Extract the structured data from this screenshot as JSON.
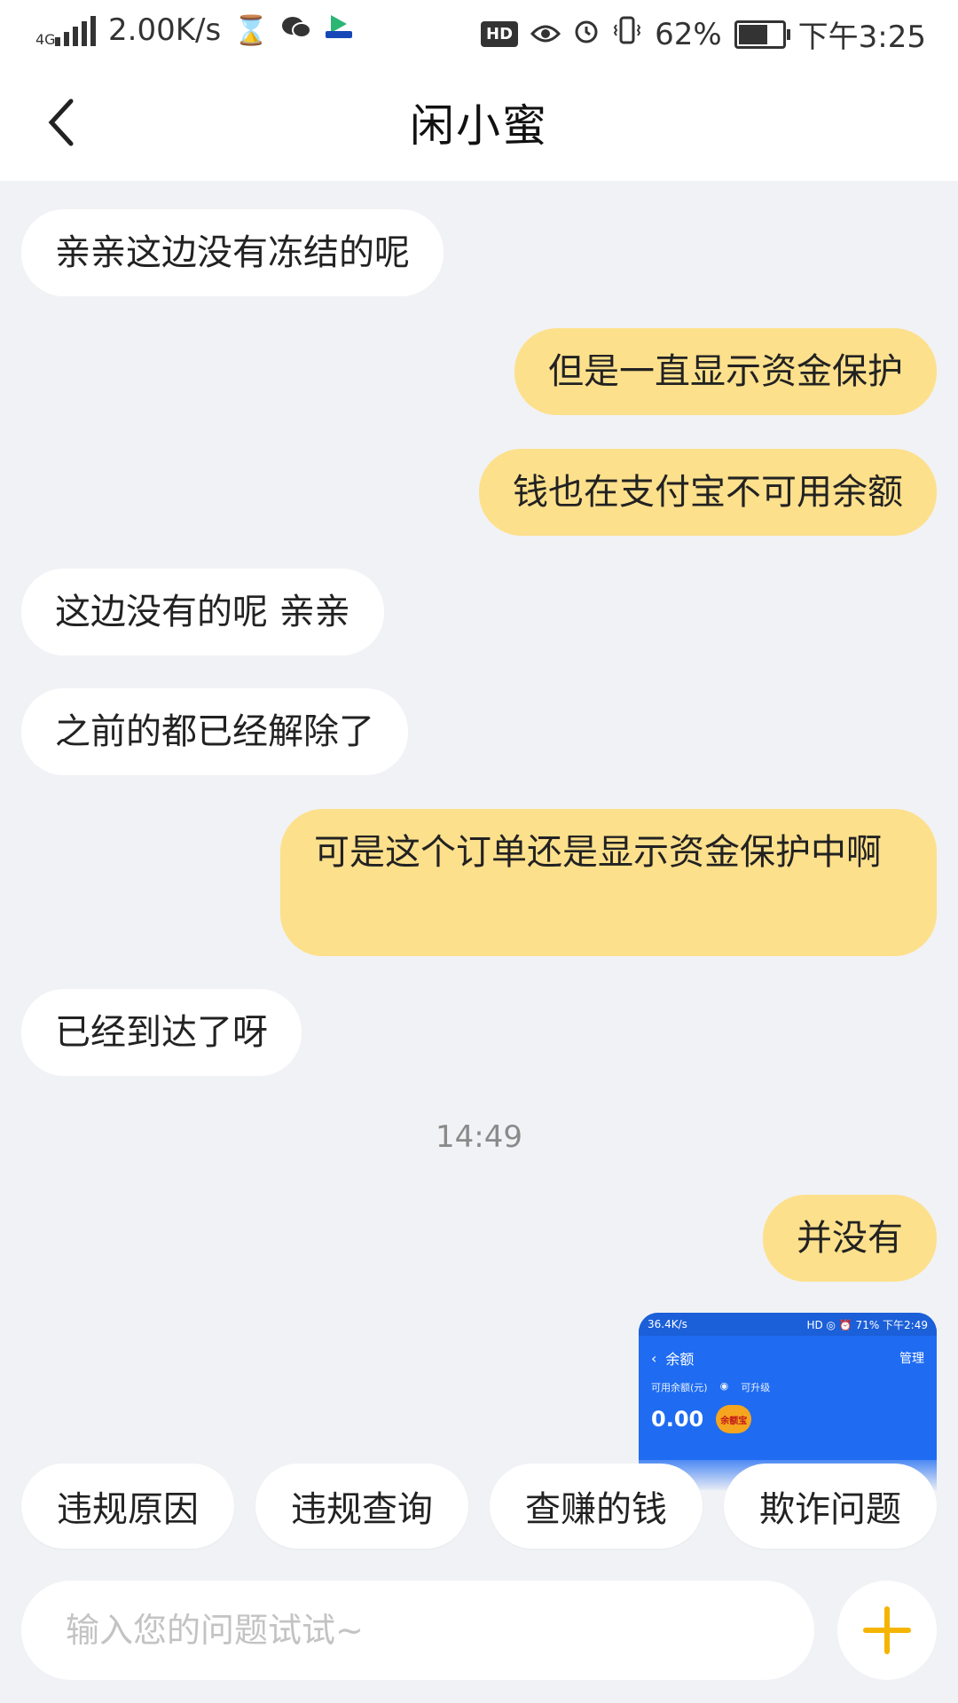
{
  "status_bar": {
    "network": "4G",
    "speed": "2.00K/s",
    "hd": "HD",
    "battery_percent": "62%",
    "time": "下午3:25",
    "icons": [
      "signal-icon",
      "hourglass-icon",
      "wechat-icon",
      "video-app-icon",
      "eye-icon",
      "alarm-icon",
      "vibrate-icon",
      "battery-icon"
    ]
  },
  "header": {
    "title": "闲小蜜",
    "back_icon": "chevron-left-icon"
  },
  "messages": [
    {
      "side": "left",
      "text": "亲亲这边没有冻结的呢"
    },
    {
      "side": "right",
      "text": "但是一直显示资金保护"
    },
    {
      "side": "right",
      "text": "钱也在支付宝不可用余额"
    },
    {
      "side": "left",
      "text": "这边没有的呢 亲亲"
    },
    {
      "side": "left",
      "text": "之前的都已经解除了"
    },
    {
      "side": "right",
      "text": "可是这个订单还是显示资金保护中啊"
    },
    {
      "side": "left",
      "text": "已经到达了呀"
    },
    {
      "side": "right",
      "text": "并没有"
    }
  ],
  "timestamp": "14:49",
  "screenshot": {
    "speed": "36.4K/s",
    "status_right": "HD ◎ ⏰ 71% 下午2:49",
    "title": "余额",
    "manage": "管理",
    "available_label": "可用余额(元)",
    "upgrade": "可升级",
    "amount": "0.00",
    "badge": "余额宝"
  },
  "quick_replies": [
    "违规原因",
    "违规查询",
    "查赚的钱",
    "欺诈问题"
  ],
  "input": {
    "placeholder": "输入您的问题试试~"
  },
  "colors": {
    "bubble_right": "#fde08c",
    "background": "#f1f2f5",
    "accent": "#f5b400"
  }
}
